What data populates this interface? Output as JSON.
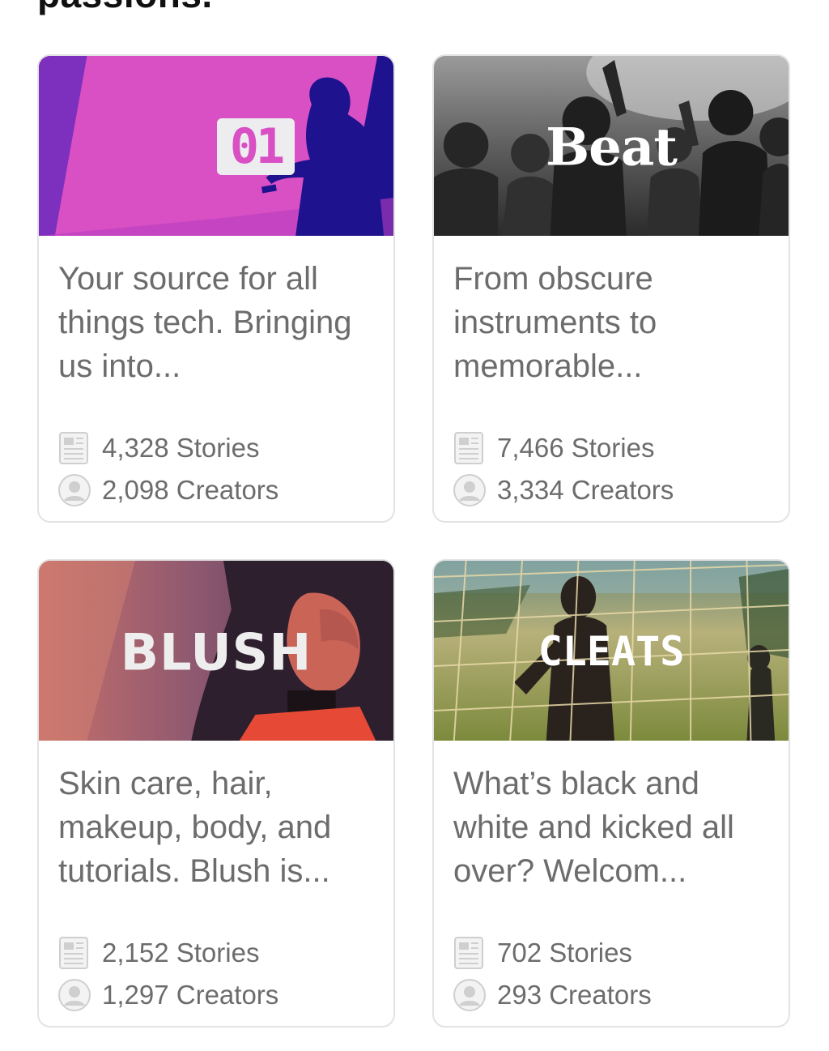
{
  "heading_partial": "passions.",
  "cards": [
    {
      "brand": "01",
      "description": "Your source for all things tech. Bringing us into...",
      "stories": "4,328 Stories",
      "creators": "2,098 Creators",
      "colors": {
        "primary": "#d94fc4",
        "secondary": "#1f128f"
      }
    },
    {
      "brand": "Beat",
      "description": "From obscure instruments to memorable...",
      "stories": "7,466 Stories",
      "creators": "3,334 Creators",
      "colors": {
        "primary": "#5a5a5a",
        "secondary": "#2b2b2b"
      }
    },
    {
      "brand": "BLUSH",
      "description": "Skin care, hair, makeup, body, and tutorials. Blush is...",
      "stories": "2,152 Stories",
      "creators": "1,297 Creators",
      "colors": {
        "primary": "#b1596a",
        "secondary": "#4d3556"
      }
    },
    {
      "brand": "CLEATS",
      "description": "What’s black and white and kicked all over? Welcom...",
      "stories": "702 Stories",
      "creators": "293 Creators",
      "colors": {
        "primary": "#8e9b4b",
        "secondary": "#3d4a2a"
      }
    }
  ],
  "icons": {
    "stories": "newspaper-icon",
    "creators": "user-avatar-icon"
  }
}
